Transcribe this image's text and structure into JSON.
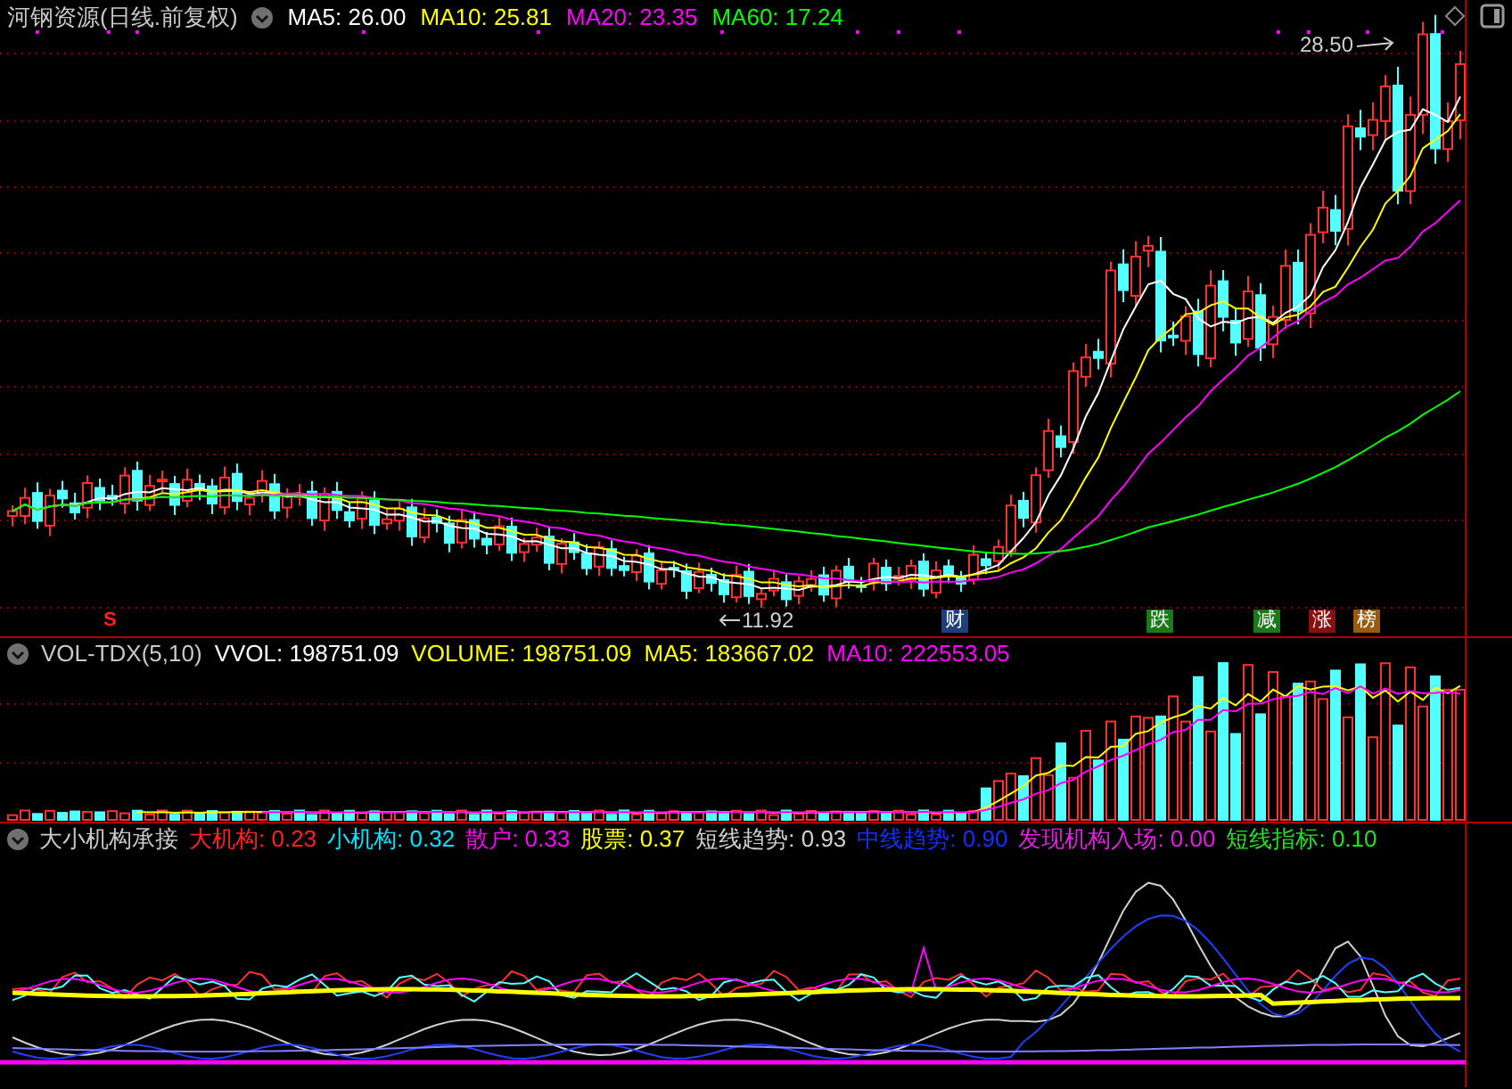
{
  "price_panel": {
    "stock": "河钢资源",
    "period": "(日线.前复权)",
    "readings": [
      {
        "text": "MA5: 26.00",
        "color": "#ffffff"
      },
      {
        "text": "MA10: 25.81",
        "color": "#ffff00"
      },
      {
        "text": "MA20: 23.35",
        "color": "#ff00ff"
      },
      {
        "text": "MA60: 17.24",
        "color": "#00ff00"
      }
    ],
    "high_label": "28.50",
    "low_label": "11.92",
    "event_tags": [
      {
        "text": "S",
        "color": "#000000"
      },
      {
        "text": "财",
        "color": "#1f3f7a"
      },
      {
        "text": "跌",
        "color": "#1a7a1a"
      },
      {
        "text": "减",
        "color": "#1a7a1a"
      },
      {
        "text": "涨",
        "color": "#8a1010"
      },
      {
        "text": "榜",
        "color": "#9a5a10"
      }
    ]
  },
  "volume_panel": {
    "name": "VOL-TDX(5,10)",
    "readings": [
      {
        "text": "VVOL: 198751.09",
        "color": "#ffffff"
      },
      {
        "text": "VOLUME: 198751.09",
        "color": "#ffff00"
      },
      {
        "text": "MA5: 183667.02",
        "color": "#ffff00"
      },
      {
        "text": "MA10: 222553.05",
        "color": "#ff00ff"
      }
    ]
  },
  "indicator_panel": {
    "name": "大小机构承接",
    "readings": [
      {
        "label": "大机构:",
        "value": "0.23",
        "color": "#ff2020"
      },
      {
        "label": "小机构:",
        "value": "0.32",
        "color": "#00e5ff"
      },
      {
        "label": "散户:",
        "value": "0.33",
        "color": "#ff00ff"
      },
      {
        "label": "股票:",
        "value": "0.37",
        "color": "#ffff00"
      },
      {
        "label": "短线趋势:",
        "value": "0.93",
        "color": "#d0d0d0"
      },
      {
        "label": "中线趋势:",
        "value": "0.90",
        "color": "#1030ff"
      },
      {
        "label": "发现机构入场:",
        "value": "0.00",
        "color": "#e020e0"
      },
      {
        "label": "短线指标:",
        "value": "0.10",
        "color": "#20e020"
      }
    ]
  }
}
